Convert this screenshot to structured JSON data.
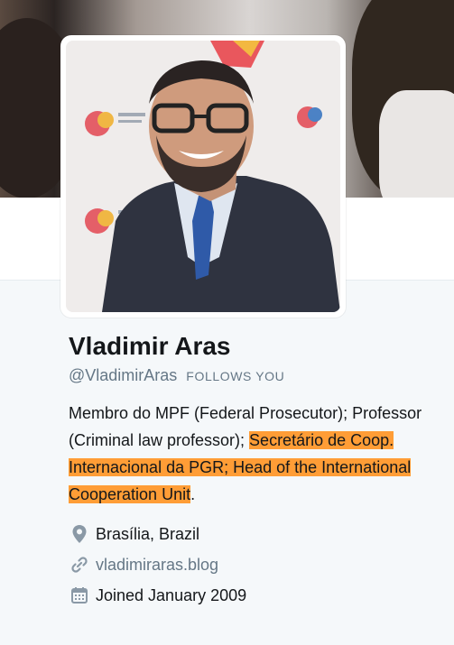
{
  "profile": {
    "name": "Vladimir Aras",
    "handle": "@VladimirAras",
    "follows_badge": "FOLLOWS YOU",
    "bio_part1": "Membro do MPF (Federal Prosecutor); Professor (Criminal law professor); ",
    "bio_highlight": "Secretário de Coop. Internacional da PGR; Head of the International Cooperation Unit",
    "bio_end": ".",
    "location": "Brasília, Brazil",
    "website": "vladimiraras.blog",
    "joined": "Joined January 2009"
  },
  "icons": {
    "location": "map-pin-icon",
    "website": "link-icon",
    "joined": "calendar-icon"
  },
  "colors": {
    "highlight": "#ff9d36",
    "secondary_text": "#657786",
    "primary_text": "#14171a"
  }
}
